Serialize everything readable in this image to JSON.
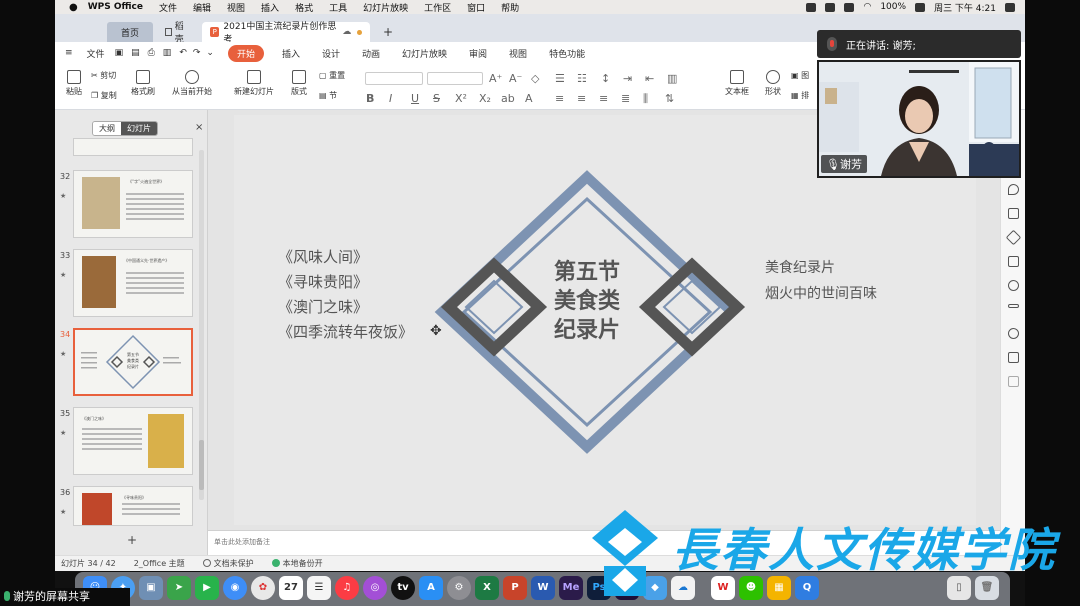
{
  "mac_menubar": {
    "app_name": "WPS Office",
    "menus": [
      "文件",
      "编辑",
      "视图",
      "插入",
      "格式",
      "工具",
      "幻灯片放映",
      "工作区",
      "窗口",
      "帮助"
    ],
    "battery": "100%",
    "datetime": "周三 下午 4:21"
  },
  "tabs": {
    "home": "首页",
    "daoke": "稻壳",
    "document": "2021中国主流纪录片创作思考",
    "add": "+"
  },
  "ribbon_menu": {
    "file": "文件",
    "items": [
      "开始",
      "插入",
      "设计",
      "动画",
      "幻灯片放映",
      "审阅",
      "视图",
      "特色功能"
    ]
  },
  "toolbar": {
    "paste": "粘贴",
    "cut": "剪切",
    "copy": "复制",
    "format_painter": "格式刷",
    "from_current": "从当前开始",
    "new_slide": "新建幻灯片",
    "layout": "版式",
    "section": "节",
    "reset": "重置",
    "textbox": "文本框",
    "shape": "形状",
    "image": "图",
    "arrange": "排"
  },
  "sidebar": {
    "tab_outline": "大纲",
    "tab_slides": "幻灯片",
    "close": "×",
    "add": "+",
    "thumbnails": [
      {
        "num": "32",
        "title": "《“字”火遍全世界》"
      },
      {
        "num": "33",
        "title": "《中国通义先·世界遗产》"
      },
      {
        "num": "34",
        "title": "第五节 美食类 纪录片"
      },
      {
        "num": "35",
        "title": "《澳门之味》"
      },
      {
        "num": "36",
        "title": "《寻味贵阳》"
      }
    ],
    "thumb_colors": [
      "#c8b48c",
      "#9a6a3a",
      "#5d7591",
      "#d9b04a",
      "#c0472a"
    ]
  },
  "slide": {
    "left_list": [
      "《风味人间》",
      "《寻味贵阳》",
      "《澳门之味》",
      "《四季流转年夜饭》"
    ],
    "center_title": [
      "第五节",
      "美食类",
      "纪录片"
    ],
    "right_list": [
      "美食纪录片",
      "烟火中的世间百味"
    ],
    "colors": {
      "outline": "#7d93b2",
      "dark": "#555555",
      "text": "#555555"
    }
  },
  "notes": {
    "placeholder": "单击此处添加备注"
  },
  "statusbar": {
    "slide_index": "幻灯片 34 / 42",
    "theme": "2_Office 主题",
    "protect": "文档未保护",
    "backup": "本地备份开"
  },
  "meeting": {
    "speaking_label": "正在讲话: 谢芳;",
    "participant_name": "谢芳",
    "share_label": "谢芳的屏幕共享"
  },
  "dock_icons": [
    "finder-icon",
    "safari-icon",
    "mail-icon",
    "photos-icon",
    "calendar-icon",
    "music-icon",
    "appstore-icon",
    "excel-icon",
    "powerpoint-icon",
    "word-icon",
    "media-encoder-icon",
    "photoshop-icon",
    "premiere-icon",
    "wps-icon",
    "wechat-icon",
    "trash-icon"
  ],
  "dock_text": {
    "cal_day": "27",
    "media_encoder": "Me",
    "photoshop": "Ps",
    "premiere": "Pr"
  },
  "watermark": {
    "text": "長春人文传媒学院",
    "color": "#1aa7e8"
  }
}
